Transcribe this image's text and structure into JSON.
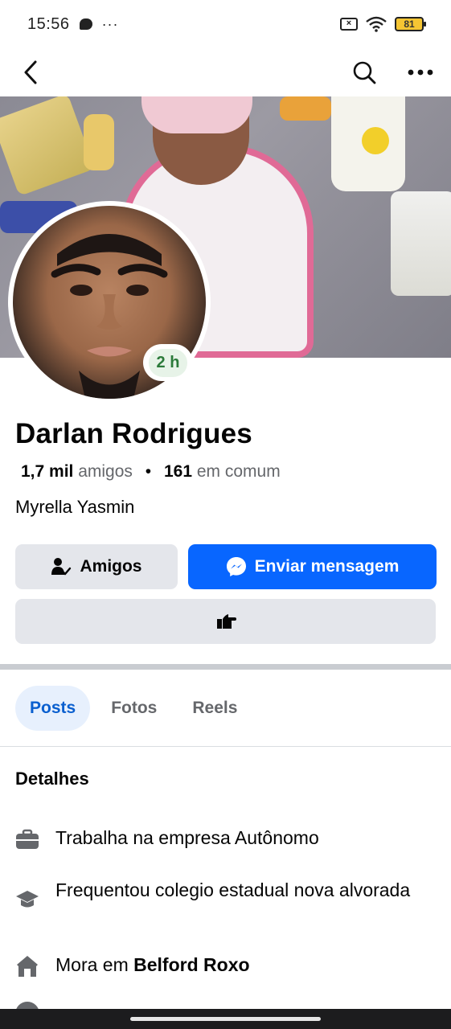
{
  "status_bar": {
    "time": "15:56",
    "dots": "···",
    "battery": "81"
  },
  "profile": {
    "name": "Darlan Rodrigues",
    "friends_count": "1,7 mil",
    "friends_label": "amigos",
    "separator": "•",
    "mutual_count": "161",
    "mutual_label": "em comum",
    "subtitle": "Myrella Yasmin",
    "story_time": "2 h"
  },
  "actions": {
    "friends_label": "Amigos",
    "message_label": "Enviar mensagem"
  },
  "tabs": [
    {
      "label": "Posts",
      "active": true
    },
    {
      "label": "Fotos",
      "active": false
    },
    {
      "label": "Reels",
      "active": false
    }
  ],
  "details": {
    "title": "Detalhes",
    "work": "Trabalha na empresa Autônomo",
    "education": "Frequentou colegio estadual nova alvorada",
    "lives_prefix": "Mora em ",
    "lives_place": "Belford Roxo"
  },
  "colors": {
    "accent": "#0866ff",
    "button_gray": "#e4e6eb",
    "story_green": "#2b7a3a"
  },
  "icons": [
    "back-arrow-icon",
    "search-icon",
    "more-icon",
    "friends-check-icon",
    "messenger-icon",
    "poke-hand-icon",
    "briefcase-icon",
    "graduation-cap-icon",
    "home-icon"
  ]
}
